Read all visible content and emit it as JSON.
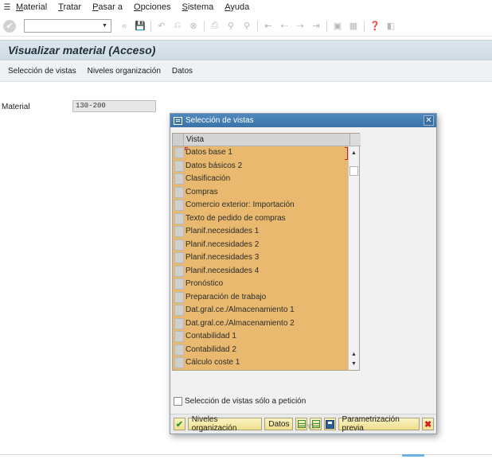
{
  "menu": {
    "items": [
      "Material",
      "Tratar",
      "Pasar a",
      "Opciones",
      "Sistema",
      "Ayuda"
    ]
  },
  "toolbar": {
    "command_field_value": "",
    "icons": [
      "save-icon",
      "back-icon",
      "exit-icon",
      "cancel-icon",
      "print-icon",
      "find-icon",
      "find-next-icon",
      "first-page-icon",
      "previous-page-icon",
      "next-page-icon",
      "last-page-icon",
      "new-session-icon",
      "shortcut-icon",
      "help-icon",
      "layout-icon"
    ]
  },
  "title": "Visualizar material (Acceso)",
  "app_toolbar": {
    "buttons": [
      "Selección de vistas",
      "Niveles organización",
      "Datos"
    ]
  },
  "form": {
    "material_label": "Material",
    "material_value": "130-200"
  },
  "dialog": {
    "title": "Selección de vistas",
    "column_header": "Vista",
    "views": [
      "Datos base 1",
      "Datos básicos 2",
      "Clasificación",
      "Compras",
      "Comercio exterior: Importación",
      "Texto de pedido de compras",
      "Planif.necesidades 1",
      "Planif.necesidades 2",
      "Planif.necesidades 3",
      "Planif.necesidades 4",
      "Pronóstico",
      "Preparación de trabajo",
      "Dat.gral.ce./Almacenamiento 1",
      "Dat.gral.ce./Almacenamiento 2",
      "Contabilidad 1",
      "Contabilidad 2",
      "Cálculo coste 1"
    ],
    "checkbox_label": "Selección de vistas sólo a petición",
    "footer": {
      "org_levels_label": "Niveles organización",
      "data_label": "Datos",
      "default_values_label": "Parametrización previa"
    }
  },
  "colors": {
    "title_bar": "#cfdbe4",
    "dialog_title": "#3b73a8",
    "grid_selected": "#e8b96e",
    "button_yellow": "#efdf8c"
  }
}
